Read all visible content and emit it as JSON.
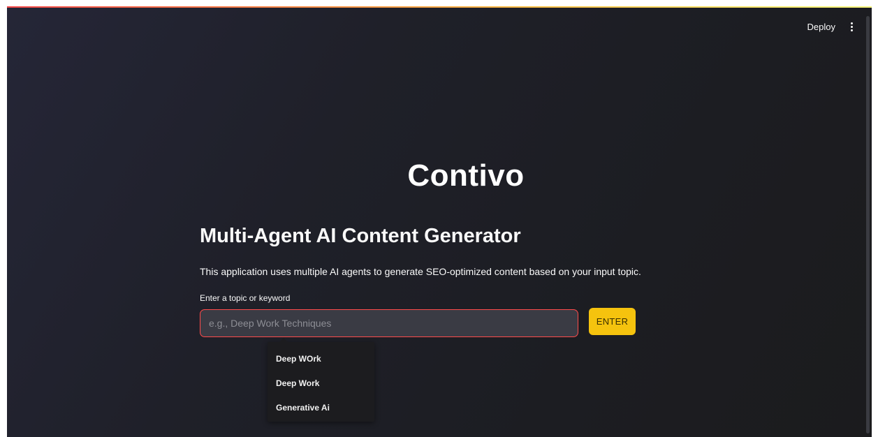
{
  "header": {
    "deploy_label": "Deploy",
    "menu_icon": "kebab-menu-icon"
  },
  "main": {
    "title": "Contivo",
    "subtitle": "Multi-Agent AI Content Generator",
    "description": "This application uses multiple AI agents to generate SEO-optimized content based on your input topic.",
    "input_label": "Enter a topic or keyword",
    "input_placeholder": "e.g., Deep Work Techniques",
    "input_value": "",
    "enter_label": "ENTER"
  },
  "autocomplete": {
    "items": [
      {
        "label": "Deep WOrk"
      },
      {
        "label": "Deep Work"
      },
      {
        "label": "Generative Ai"
      }
    ]
  },
  "colors": {
    "accent": "#f5c30e",
    "input_border": "#ff4b4b",
    "background": "#1f2029"
  }
}
